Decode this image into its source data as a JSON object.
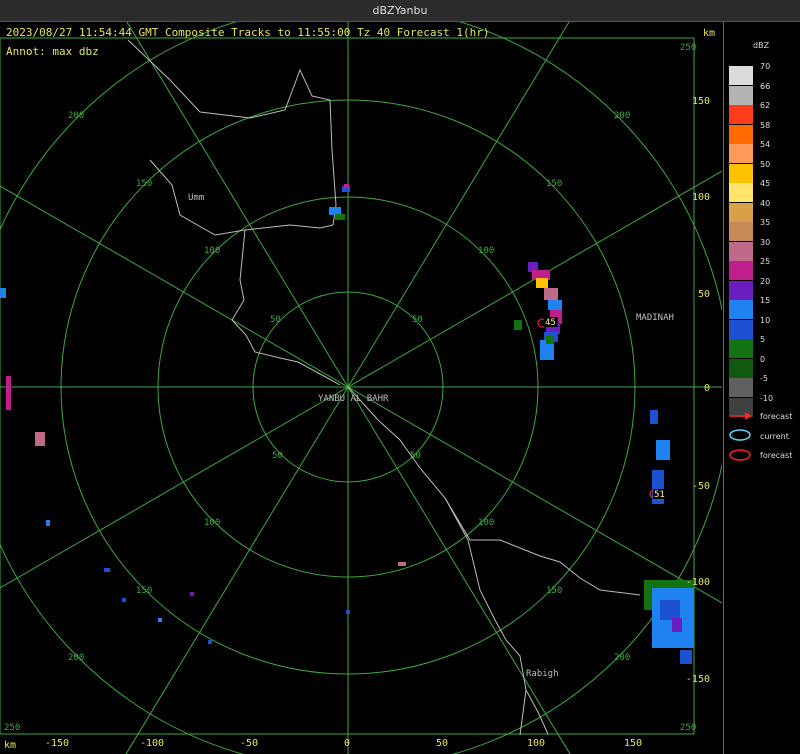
{
  "window": {
    "title": "dBZYanbu"
  },
  "header": {
    "line1": "2023/08/27 11:54:44 GMT Composite Tracks to 11:55:00 Tz 40 Forecast 1(hr)",
    "annot": "Annot: max dbz",
    "km_top": "km",
    "km_bottom": "km"
  },
  "axes": {
    "x_ticks": [
      "-150",
      "-100",
      "-50",
      "0",
      "50",
      "100",
      "150"
    ],
    "y_ticks": [
      "150",
      "100",
      "50",
      "0",
      "-50",
      "-100",
      "-150"
    ],
    "corner_ticks": [
      "250",
      "250",
      "250"
    ]
  },
  "rings": {
    "labels": [
      "50",
      "100",
      "150",
      "200"
    ]
  },
  "places": {
    "center": "YANBU AL BAHR",
    "umm": "Umm",
    "madinah": "MADINAH",
    "rabigh": "Rabigh"
  },
  "cells": {
    "cell_a_label": "45",
    "cell_b_label": "51"
  },
  "legend": {
    "title": "dBZ",
    "scale": [
      {
        "value": "70",
        "color": "#dcdcdc"
      },
      {
        "value": "66",
        "color": "#b4b4b4"
      },
      {
        "value": "62",
        "color": "#ff3b1e"
      },
      {
        "value": "58",
        "color": "#ff6a00"
      },
      {
        "value": "54",
        "color": "#ff9a5a"
      },
      {
        "value": "50",
        "color": "#ffc200"
      },
      {
        "value": "45",
        "color": "#ffe36a"
      },
      {
        "value": "40",
        "color": "#d9a04a"
      },
      {
        "value": "35",
        "color": "#c48a58"
      },
      {
        "value": "30",
        "color": "#c06a8a"
      },
      {
        "value": "25",
        "color": "#c01e8c"
      },
      {
        "value": "20",
        "color": "#6a1ec0"
      },
      {
        "value": "15",
        "color": "#1e82f0"
      },
      {
        "value": "10",
        "color": "#1e50d2"
      },
      {
        "value": "5",
        "color": "#127312"
      },
      {
        "value": "0",
        "color": "#0f5a0f"
      },
      {
        "value": "-5",
        "color": "#606060"
      },
      {
        "value": "-10",
        "color": "#404040"
      }
    ],
    "key_forecast_vector": "forecast",
    "key_current": "current",
    "key_forecast_ellipse": "forecast"
  }
}
